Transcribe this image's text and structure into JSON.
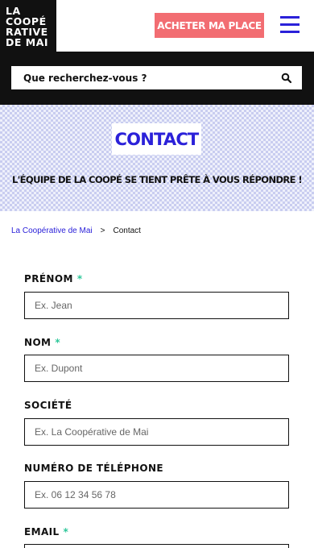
{
  "header": {
    "logo_lines": [
      "LA",
      "COOPÉ",
      "RATIVE",
      "DE MAI"
    ],
    "cta_label": "ACHETER MA PLACE",
    "accent": "#2b21d9",
    "cta_color": "#f26d72"
  },
  "search": {
    "placeholder": "Que recherchez-vous ?",
    "icon": "search-icon"
  },
  "hero": {
    "title": "CONTACT",
    "subtitle": "L'ÉQUIPE DE LA COOPÉ SE TIENT PRÊTE À VOUS RÉPONDRE !"
  },
  "breadcrumb": {
    "home": "La Coopérative de Mai",
    "separator": ">",
    "current": "Contact"
  },
  "form": {
    "required_mark": "*",
    "fields": [
      {
        "label": "PRÉNOM",
        "required": true,
        "placeholder": "Ex. Jean"
      },
      {
        "label": "NOM",
        "required": true,
        "placeholder": "Ex. Dupont"
      },
      {
        "label": "SOCIÉTÉ",
        "required": false,
        "placeholder": "Ex. La Coopérative de Mai"
      },
      {
        "label": "NUMÉRO DE TÉLÉPHONE",
        "required": false,
        "placeholder": "Ex. 06 12 34 56 78"
      },
      {
        "label": "EMAIL",
        "required": true,
        "placeholder": ""
      }
    ]
  }
}
